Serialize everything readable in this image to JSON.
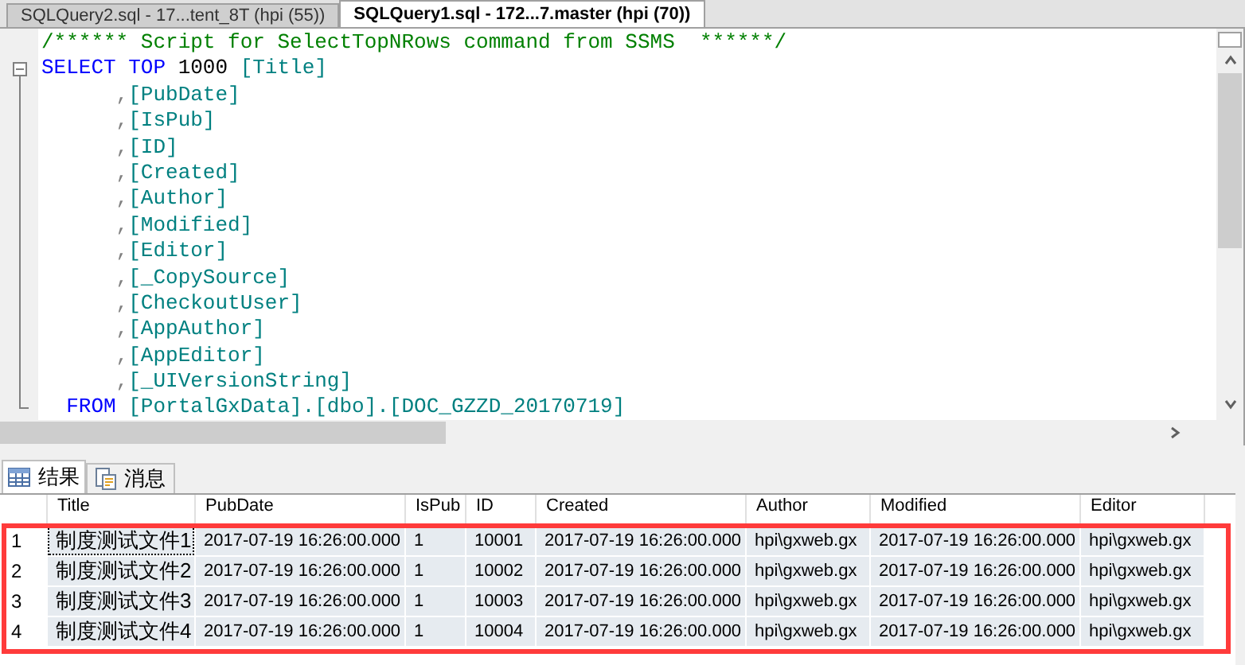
{
  "doc_tabs": [
    {
      "label": "SQLQuery2.sql - 17...tent_8T (hpi (55))",
      "selected": false
    },
    {
      "label": "SQLQuery1.sql - 172...7.master (hpi (70))",
      "selected": true
    }
  ],
  "editor": {
    "lines": [
      {
        "tokens": [
          {
            "kind": "comment",
            "text": "/****** Script for SelectTopNRows command from SSMS  ******/"
          }
        ]
      },
      {
        "collapsible": true,
        "tokens": [
          {
            "kind": "keyword",
            "text": "SELECT "
          },
          {
            "kind": "keyword",
            "text": "TOP"
          },
          {
            "kind": "plain",
            "text": " 1000 "
          },
          {
            "kind": "ident",
            "text": "[Title]"
          }
        ]
      },
      {
        "tokens": [
          {
            "kind": "punct",
            "text": "      ,"
          },
          {
            "kind": "ident",
            "text": "[PubDate]"
          }
        ]
      },
      {
        "tokens": [
          {
            "kind": "punct",
            "text": "      ,"
          },
          {
            "kind": "ident",
            "text": "[IsPub]"
          }
        ]
      },
      {
        "tokens": [
          {
            "kind": "punct",
            "text": "      ,"
          },
          {
            "kind": "ident",
            "text": "[ID]"
          }
        ]
      },
      {
        "tokens": [
          {
            "kind": "punct",
            "text": "      ,"
          },
          {
            "kind": "ident",
            "text": "[Created]"
          }
        ]
      },
      {
        "tokens": [
          {
            "kind": "punct",
            "text": "      ,"
          },
          {
            "kind": "ident",
            "text": "[Author]"
          }
        ]
      },
      {
        "tokens": [
          {
            "kind": "punct",
            "text": "      ,"
          },
          {
            "kind": "ident",
            "text": "[Modified]"
          }
        ]
      },
      {
        "tokens": [
          {
            "kind": "punct",
            "text": "      ,"
          },
          {
            "kind": "ident",
            "text": "[Editor]"
          }
        ]
      },
      {
        "tokens": [
          {
            "kind": "punct",
            "text": "      ,"
          },
          {
            "kind": "ident",
            "text": "[_CopySource]"
          }
        ]
      },
      {
        "tokens": [
          {
            "kind": "punct",
            "text": "      ,"
          },
          {
            "kind": "ident",
            "text": "[CheckoutUser]"
          }
        ]
      },
      {
        "tokens": [
          {
            "kind": "punct",
            "text": "      ,"
          },
          {
            "kind": "ident",
            "text": "[AppAuthor]"
          }
        ]
      },
      {
        "tokens": [
          {
            "kind": "punct",
            "text": "      ,"
          },
          {
            "kind": "ident",
            "text": "[AppEditor]"
          }
        ]
      },
      {
        "tokens": [
          {
            "kind": "punct",
            "text": "      ,"
          },
          {
            "kind": "ident",
            "text": "[_UIVersionString]"
          }
        ]
      },
      {
        "tokens": [
          {
            "kind": "keyword",
            "text": "  FROM "
          },
          {
            "kind": "ident",
            "text": "[PortalGxData].[dbo].[DOC_GZZD_20170719]"
          }
        ]
      }
    ]
  },
  "result_tabs": [
    {
      "label": "结果",
      "kind": "grid",
      "selected": true
    },
    {
      "label": "消息",
      "kind": "messages",
      "selected": false
    }
  ],
  "grid": {
    "highlighted": true,
    "columns": [
      "Title",
      "PubDate",
      "IsPub",
      "ID",
      "Created",
      "Author",
      "Modified",
      "Editor"
    ],
    "rows": [
      {
        "number": "1",
        "selected": true,
        "focused": true,
        "cells": [
          "制度测试文件1",
          "2017-07-19 16:26:00.000",
          "1",
          "10001",
          "2017-07-19 16:26:00.000",
          "hpi\\gxweb.gx",
          "2017-07-19 16:26:00.000",
          "hpi\\gxweb.gx"
        ]
      },
      {
        "number": "2",
        "selected": true,
        "focused": false,
        "cells": [
          "制度测试文件2",
          "2017-07-19 16:26:00.000",
          "1",
          "10002",
          "2017-07-19 16:26:00.000",
          "hpi\\gxweb.gx",
          "2017-07-19 16:26:00.000",
          "hpi\\gxweb.gx"
        ]
      },
      {
        "number": "3",
        "selected": true,
        "focused": false,
        "cells": [
          "制度测试文件3",
          "2017-07-19 16:26:00.000",
          "1",
          "10003",
          "2017-07-19 16:26:00.000",
          "hpi\\gxweb.gx",
          "2017-07-19 16:26:00.000",
          "hpi\\gxweb.gx"
        ]
      },
      {
        "number": "4",
        "selected": true,
        "focused": false,
        "cells": [
          "制度测试文件4",
          "2017-07-19 16:26:00.000",
          "1",
          "10004",
          "2017-07-19 16:26:00.000",
          "hpi\\gxweb.gx",
          "2017-07-19 16:26:00.000",
          "hpi\\gxweb.gx"
        ]
      }
    ]
  }
}
